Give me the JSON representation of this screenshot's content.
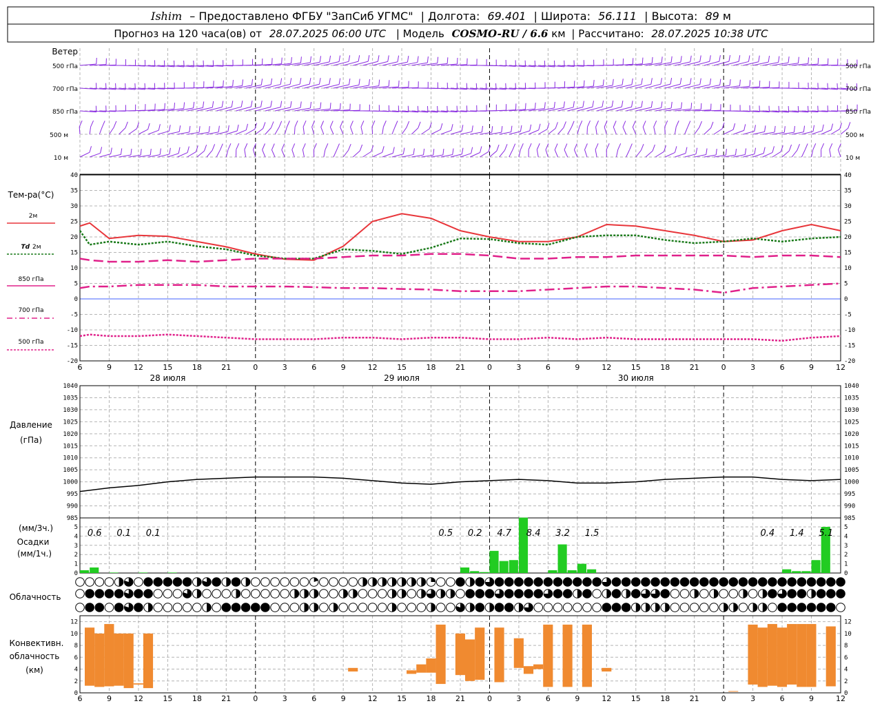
{
  "header": {
    "station": "Ishim",
    "provider": "– Предоставлено ФГБУ \"ЗапСиб УГМС\"",
    "lon_label": "| Долгота:",
    "lon_value": "69.401",
    "lat_label": "| Широта:",
    "lat_value": "56.111",
    "alt_label": "| Высота:",
    "alt_value": "89",
    "alt_unit": "м",
    "line2_prefix": "Прогноз на 120 часа(ов) от",
    "run_time": "28.07.2025 06:00 UTC",
    "model_label": "| Модель",
    "model_name": "COSMO-RU / 6.6",
    "model_unit": "км",
    "calc_label": "| Рассчитано:",
    "calc_time": "28.07.2025 10:38 UTC"
  },
  "colors": {
    "wind": "#8a2be2",
    "t2m": "#e8353a",
    "td2m": "#1a7a1a",
    "t850": "#e0208a",
    "t700": "#e0208a",
    "t500": "#e0208a",
    "zero_line": "#4060ff",
    "precip": "#22cc22",
    "convective": "#f08a30",
    "pressure": "#000000"
  },
  "time_axis": {
    "tick_labels": [
      "6",
      "9",
      "12",
      "15",
      "18",
      "21",
      "0",
      "3",
      "6",
      "9",
      "12",
      "15",
      "18",
      "21",
      "0",
      "3",
      "6",
      "9",
      "12",
      "15",
      "18",
      "21",
      "0",
      "3",
      "6",
      "9",
      "12"
    ],
    "day_labels": [
      "28 июля",
      "29 июля",
      "30 июля"
    ],
    "day_label_hours": [
      9,
      33,
      57
    ]
  },
  "chart_data": [
    {
      "type": "wind_barbs",
      "title": "Ветер",
      "levels": [
        "500 гПа",
        "700 гПа",
        "850 гПа",
        "500 м",
        "10 м"
      ],
      "x_hours": [
        0,
        78
      ],
      "note_style": "wind barbs per level"
    },
    {
      "type": "line",
      "ylabel": "Тем-ра(°C)",
      "ylim": [
        -20,
        40
      ],
      "yticks": [
        40,
        35,
        30,
        25,
        20,
        15,
        10,
        5,
        0,
        -5,
        -10,
        -15,
        -20
      ],
      "x_hours": [
        0,
        1,
        3,
        6,
        9,
        12,
        15,
        18,
        21,
        24,
        27,
        30,
        33,
        36,
        39,
        42,
        45,
        48,
        51,
        54,
        57,
        60,
        63,
        66,
        69,
        72,
        75,
        78
      ],
      "series": [
        {
          "name": "2м",
          "key": "t2m",
          "values": [
            23.5,
            24.5,
            19.5,
            20.5,
            20.2,
            18.5,
            16.8,
            14.5,
            12.8,
            12.5,
            17,
            25,
            27.5,
            26,
            22,
            20,
            18.5,
            18.5,
            20,
            24,
            23.5,
            22,
            20.5,
            18.5,
            19,
            22,
            24,
            22
          ]
        },
        {
          "name": "Td 2м",
          "key": "td2m",
          "values": [
            22,
            17.5,
            18.5,
            17.5,
            18.5,
            17,
            16,
            14,
            13,
            13,
            16,
            15.5,
            14.5,
            16.5,
            19.5,
            19.3,
            18,
            17.5,
            20,
            20.5,
            20.5,
            19,
            18,
            18.5,
            19.5,
            18.5,
            19.5,
            20
          ]
        },
        {
          "name": "850 гПа",
          "key": "t850",
          "values": [
            13,
            12.5,
            12,
            12,
            12.5,
            12,
            12.5,
            13,
            13,
            13,
            13.5,
            14,
            14,
            14.5,
            14.5,
            14,
            13,
            13,
            13.5,
            13.5,
            14,
            14,
            14,
            14,
            13.5,
            14,
            14,
            13.5
          ]
        },
        {
          "name": "700 гПа",
          "key": "t700",
          "values": [
            3.5,
            4,
            4,
            4.5,
            4.5,
            4.5,
            4,
            4,
            4,
            3.8,
            3.5,
            3.5,
            3.2,
            3,
            2.5,
            2.5,
            2.5,
            3,
            3.5,
            4,
            4,
            3.5,
            3,
            2,
            3.5,
            4,
            4.5,
            5
          ]
        },
        {
          "name": "500 гПа",
          "key": "t500",
          "values": [
            -12,
            -11.5,
            -12,
            -12,
            -11.5,
            -12,
            -12.5,
            -13,
            -13,
            -13,
            -12.5,
            -12.5,
            -13,
            -12.5,
            -12.5,
            -13,
            -13,
            -12.5,
            -13,
            -12.5,
            -13,
            -13,
            -13,
            -13,
            -13,
            -13.5,
            -12.5,
            -12
          ]
        }
      ]
    },
    {
      "type": "line",
      "ylabel": "Давление",
      "ylabel_unit": "(гПа)",
      "ylim": [
        985,
        1040
      ],
      "yticks": [
        1040,
        1035,
        1030,
        1025,
        1020,
        1015,
        1010,
        1005,
        1000,
        995,
        990,
        985
      ],
      "x_hours": [
        0,
        3,
        6,
        9,
        12,
        15,
        18,
        21,
        24,
        27,
        30,
        33,
        36,
        39,
        42,
        45,
        48,
        51,
        54,
        57,
        60,
        63,
        66,
        69,
        72,
        75,
        78
      ],
      "series": [
        {
          "name": "pressure",
          "values": [
            996,
            997.5,
            998.5,
            1000,
            1001,
            1001.5,
            1002,
            1002,
            1002,
            1001.5,
            1000.5,
            999.5,
            999,
            1000,
            1000.5,
            1001,
            1000.5,
            999.5,
            999.5,
            1000,
            1001,
            1001.5,
            1002,
            1002,
            1001,
            1000.5,
            1001
          ]
        }
      ]
    },
    {
      "type": "bar",
      "ylabel_top": "(мм/3ч.)",
      "ylabel": "Осадки",
      "ylabel_unit": "(мм/1ч.)",
      "ylim": [
        0,
        5
      ],
      "yticks": [
        5,
        4,
        3,
        2,
        1,
        0
      ],
      "bar_hours": [
        0,
        1,
        3,
        6,
        9,
        39,
        40,
        41,
        42,
        43,
        44,
        45,
        48,
        49,
        50,
        51,
        52,
        72,
        73,
        74,
        75,
        76
      ],
      "values": [
        0.3,
        0.6,
        0.05,
        0.05,
        0.05,
        0.6,
        0.2,
        0.1,
        2.4,
        1.3,
        1.4,
        6,
        0.3,
        3.1,
        0.3,
        1.0,
        0.4,
        0.4,
        0.2,
        0.2,
        1.4,
        5,
        0.3
      ],
      "annotations": [
        {
          "hour": 1.5,
          "text": "0.6"
        },
        {
          "hour": 4.5,
          "text": "0.1"
        },
        {
          "hour": 7.5,
          "text": "0.1"
        },
        {
          "hour": 37.5,
          "text": "0.5"
        },
        {
          "hour": 40.5,
          "text": "0.2"
        },
        {
          "hour": 43.5,
          "text": "4.7"
        },
        {
          "hour": 46.5,
          "text": "8.4"
        },
        {
          "hour": 49.5,
          "text": "3.2"
        },
        {
          "hour": 52.5,
          "text": "1.5"
        },
        {
          "hour": 70.5,
          "text": "0.4"
        },
        {
          "hour": 73.5,
          "text": "1.4"
        },
        {
          "hour": 76.5,
          "text": "5.1"
        }
      ]
    },
    {
      "type": "cloud_cover",
      "ylabel": "Облачность",
      "rows": 3,
      "hours_step": 1,
      "fractions": [
        [
          0,
          0,
          0,
          0,
          0.5,
          0.8,
          0,
          1,
          1,
          1,
          1,
          1,
          0.5,
          0.8,
          1,
          0.5,
          1,
          0.5,
          0,
          0,
          0,
          0,
          0,
          0,
          0.2,
          0,
          0,
          0,
          0,
          0.5,
          0.5,
          0.5,
          0.5,
          0.5,
          0.5,
          0.5,
          0.25,
          0,
          0,
          1,
          0.5,
          1,
          0.75,
          1,
          1,
          1,
          1,
          1,
          1,
          1,
          1,
          1,
          1,
          1,
          0.75,
          1,
          1,
          1,
          1,
          1,
          1,
          1,
          1,
          1,
          1,
          1,
          1,
          1,
          1,
          1,
          1,
          1,
          1,
          1,
          1,
          1,
          1,
          1,
          1,
          1,
          0.75,
          0.75,
          0.75,
          0.75,
          0.75,
          0.5,
          0.5,
          0.5,
          0.5,
          0.5,
          0.5,
          0.5,
          0,
          0.5,
          0,
          0.5,
          0.5,
          0.5,
          0.5,
          0.5,
          0,
          0,
          0,
          0.25,
          1,
          1,
          1,
          1,
          1
        ],
        [
          0,
          1,
          1,
          1,
          1,
          0.8,
          1,
          1,
          0,
          0,
          0,
          0.8,
          0.5,
          0,
          0,
          0,
          0.5,
          0,
          0,
          0,
          0,
          0,
          0.5,
          0.5,
          0.5,
          0,
          0,
          0.5,
          0.5,
          0,
          0,
          0,
          0.5,
          0.5,
          0,
          0.5,
          0.75,
          0.5,
          0.5,
          0,
          1,
          1,
          1,
          0.75,
          1,
          1,
          1,
          1,
          0.75,
          1,
          1,
          0.5,
          1,
          0,
          0.5,
          1,
          0.5,
          1,
          0.75,
          0.75,
          1,
          0,
          0,
          0.5,
          0,
          0.5,
          0,
          0,
          0.5,
          0,
          0.5,
          1,
          0.75,
          1,
          1,
          0.5,
          1,
          1,
          1,
          0,
          0,
          0,
          0.5,
          0,
          1,
          0,
          0.75,
          1,
          0,
          0.5,
          0,
          0,
          0.5,
          0.5,
          0,
          0.75,
          1,
          0,
          0,
          0,
          0,
          1,
          1,
          0,
          0.75,
          1
        ],
        [
          0,
          1,
          1,
          0,
          1,
          0.8,
          1,
          0.5,
          0,
          0,
          0,
          0,
          0,
          0.5,
          0,
          1,
          1,
          1,
          1,
          1,
          0,
          0,
          0,
          0.5,
          0.5,
          0,
          0.5,
          0,
          0,
          0,
          0,
          0,
          0.5,
          0,
          0,
          0,
          0.5,
          0,
          0,
          0.8,
          0.5,
          1,
          0.5,
          1,
          1,
          0.5,
          0.75,
          0,
          0,
          0,
          0,
          0,
          0,
          0,
          1,
          1,
          1,
          0.5,
          0.5,
          0.5,
          0.5,
          0,
          0,
          0,
          0,
          0,
          0.5,
          0.5,
          0,
          0.5,
          0.5,
          0,
          1,
          1,
          1,
          1,
          1,
          1,
          0,
          0,
          0,
          0,
          0.5,
          0.5,
          0,
          0,
          0.75,
          0,
          0,
          0,
          0,
          0,
          0,
          0,
          0,
          0,
          0.5,
          1,
          1,
          1,
          0.5,
          1,
          0,
          0,
          0.75,
          0.5
        ]
      ]
    },
    {
      "type": "range_bar",
      "ylabel": "Конвективн.",
      "ylabel2": "облачность",
      "ylabel_unit": "(км)",
      "ylim": [
        0,
        13
      ],
      "yticks": [
        12,
        10,
        8,
        6,
        4,
        2,
        0
      ],
      "bars": [
        {
          "h": 0,
          "lo": 1.2,
          "hi": 11
        },
        {
          "h": 1,
          "lo": 1.0,
          "hi": 10
        },
        {
          "h": 2,
          "lo": 1.1,
          "hi": 11.6
        },
        {
          "h": 3,
          "lo": 1.2,
          "hi": 10
        },
        {
          "h": 4,
          "lo": 0.8,
          "hi": 10
        },
        {
          "h": 5,
          "lo": 1.4,
          "hi": 1.6
        },
        {
          "h": 6,
          "lo": 0.8,
          "hi": 10
        },
        {
          "h": 27,
          "lo": 3.6,
          "hi": 4.2
        },
        {
          "h": 33,
          "lo": 3.2,
          "hi": 3.8
        },
        {
          "h": 34,
          "lo": 3.4,
          "hi": 4.8
        },
        {
          "h": 35,
          "lo": 3.4,
          "hi": 5.8
        },
        {
          "h": 36,
          "lo": 1.5,
          "hi": 11.5
        },
        {
          "h": 38,
          "lo": 3,
          "hi": 10
        },
        {
          "h": 39,
          "lo": 2.0,
          "hi": 9
        },
        {
          "h": 40,
          "lo": 2.2,
          "hi": 11
        },
        {
          "h": 42,
          "lo": 1.8,
          "hi": 11
        },
        {
          "h": 44,
          "lo": 4.2,
          "hi": 9.2
        },
        {
          "h": 45,
          "lo": 3.2,
          "hi": 4.5
        },
        {
          "h": 46,
          "lo": 4,
          "hi": 4.8
        },
        {
          "h": 47,
          "lo": 1.0,
          "hi": 11.5
        },
        {
          "h": 49,
          "lo": 1.0,
          "hi": 11.5
        },
        {
          "h": 51,
          "lo": 1.0,
          "hi": 11.5
        },
        {
          "h": 53,
          "lo": 3.6,
          "hi": 4.2
        },
        {
          "h": 66,
          "lo": 0.2,
          "hi": 0.3
        },
        {
          "h": 68,
          "lo": 1.4,
          "hi": 11.5
        },
        {
          "h": 69,
          "lo": 1.0,
          "hi": 11
        },
        {
          "h": 70,
          "lo": 1.2,
          "hi": 11.6
        },
        {
          "h": 71,
          "lo": 1.0,
          "hi": 11
        },
        {
          "h": 72,
          "lo": 1.4,
          "hi": 11.6
        },
        {
          "h": 73,
          "lo": 1.0,
          "hi": 11.6
        },
        {
          "h": 74,
          "lo": 1.0,
          "hi": 11.6
        },
        {
          "h": 76,
          "lo": 1.1,
          "hi": 11.2
        }
      ]
    }
  ],
  "legend": {
    "t2m": "2м",
    "td_italic": "Td",
    "td_suffix": "2м",
    "t850": "850 гПа",
    "t700": "700 гПа",
    "t500": "500 гПа"
  }
}
